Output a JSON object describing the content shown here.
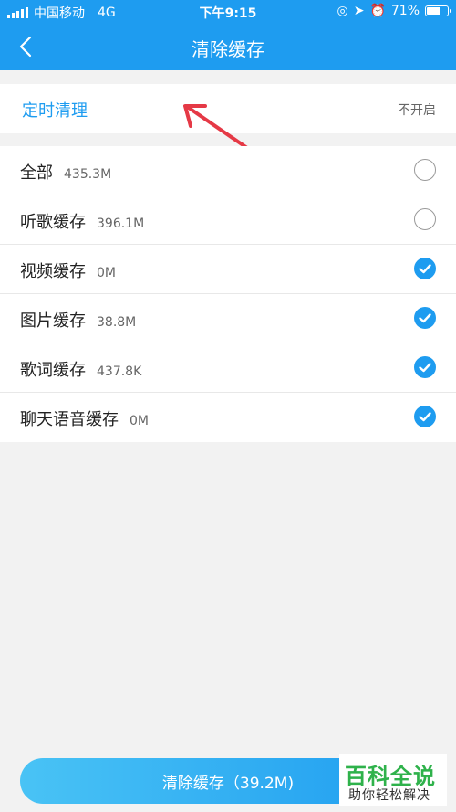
{
  "status_bar": {
    "carrier": "中国移动",
    "network": "4G",
    "time": "下午9:15",
    "battery": "71%",
    "battery_level": 0.71
  },
  "nav": {
    "title": "清除缓存",
    "back_icon": "chevron-left-icon"
  },
  "timer": {
    "label": "定时清理",
    "value": "不开启"
  },
  "items": [
    {
      "label": "全部",
      "size": "435.3M",
      "checked": false
    },
    {
      "label": "听歌缓存",
      "size": "396.1M",
      "checked": false
    },
    {
      "label": "视频缓存",
      "size": "0M",
      "checked": true
    },
    {
      "label": "图片缓存",
      "size": "38.8M",
      "checked": true
    },
    {
      "label": "歌词缓存",
      "size": "437.8K",
      "checked": true
    },
    {
      "label": "聊天语音缓存",
      "size": "0M",
      "checked": true
    }
  ],
  "clear_button": {
    "label": "清除缓存（39.2M)"
  },
  "watermark": {
    "top": "百科全说",
    "bottom": "助你轻松解决"
  },
  "colors": {
    "accent": "#1e9cf0",
    "annotation_arrow": "#e53946",
    "watermark": "#2fb24b"
  }
}
